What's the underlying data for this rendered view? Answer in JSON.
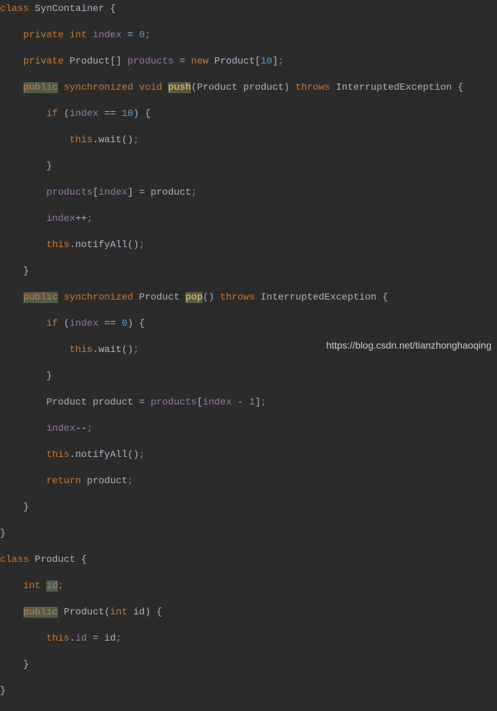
{
  "code": {
    "l1": {
      "kw1": "class",
      "name": "SynContainer",
      "brace": "{"
    },
    "l2": {
      "kw1": "private",
      "kw2": "int",
      "field": "index",
      "eq": "=",
      "val": "0",
      "semi": ";"
    },
    "l3": {
      "kw1": "private",
      "type": "Product[]",
      "field": "products",
      "eq": "=",
      "kw2": "new",
      "type2": "Product[",
      "val": "10",
      "close": "]",
      "semi": ";"
    },
    "l4": {
      "kw1": "public",
      "kw2": "synchronized",
      "kw3": "void",
      "method": "push",
      "args_open": "(",
      "ptype": "Product",
      "pname": "product",
      "args_close": ")",
      "kw4": "throws",
      "ex": "InterruptedException",
      "brace": "{"
    },
    "l5": {
      "kw1": "if",
      "open": "(",
      "field": "index",
      "op": "==",
      "val": "10",
      "close": ")",
      "brace": "{"
    },
    "l6": {
      "kw1": "this",
      "dot": ".",
      "call": "wait()",
      "semi": ";"
    },
    "l7": {
      "brace": "}"
    },
    "l8": {
      "field": "products",
      "open": "[",
      "idx": "index",
      "close": "]",
      "eq": "=",
      "rhs": "product",
      "semi": ";"
    },
    "l9": {
      "field": "index",
      "op": "++",
      "semi": ";"
    },
    "l10": {
      "kw1": "this",
      "dot": ".",
      "call": "notifyAll()",
      "semi": ";"
    },
    "l11": {
      "brace": "}"
    },
    "l12": {
      "kw1": "public",
      "kw2": "synchronized",
      "ret": "Product",
      "method": "pop",
      "args": "()",
      "kw3": "throws",
      "ex": "InterruptedException",
      "brace": "{"
    },
    "l13": {
      "kw1": "if",
      "open": "(",
      "field": "index",
      "op": "==",
      "val": "0",
      "close": ")",
      "brace": "{"
    },
    "l14": {
      "kw1": "this",
      "dot": ".",
      "call": "wait()",
      "semi": ";"
    },
    "l15": {
      "brace": "}"
    },
    "l16": {
      "type": "Product",
      "name": "product",
      "eq": "=",
      "field": "products",
      "open": "[",
      "idx": "index",
      "op": "-",
      "val": "1",
      "close": "]",
      "semi": ";"
    },
    "l17": {
      "field": "index",
      "op": "--",
      "semi": ";"
    },
    "l18": {
      "kw1": "this",
      "dot": ".",
      "call": "notifyAll()",
      "semi": ";"
    },
    "l19": {
      "kw1": "return",
      "name": "product",
      "semi": ";"
    },
    "l20": {
      "brace": "}"
    },
    "l21": {
      "brace": "}"
    },
    "l22": {
      "kw1": "class",
      "name": "Product",
      "brace": "{"
    },
    "l23": {
      "kw1": "int",
      "field": "id",
      "semi": ";"
    },
    "l24": {
      "kw1": "public",
      "ctor": "Product",
      "open": "(",
      "ptype": "int",
      "pname": "id",
      "close": ")",
      "brace": "{"
    },
    "l25": {
      "kw1": "this",
      "dot": ".",
      "field": "id",
      "eq": "=",
      "rhs": "id",
      "semi": ";"
    },
    "l26": {
      "brace": "}"
    },
    "l27": {
      "brace": "}"
    }
  },
  "watermark": "https://blog.csdn.net/tianzhonghaoqing"
}
